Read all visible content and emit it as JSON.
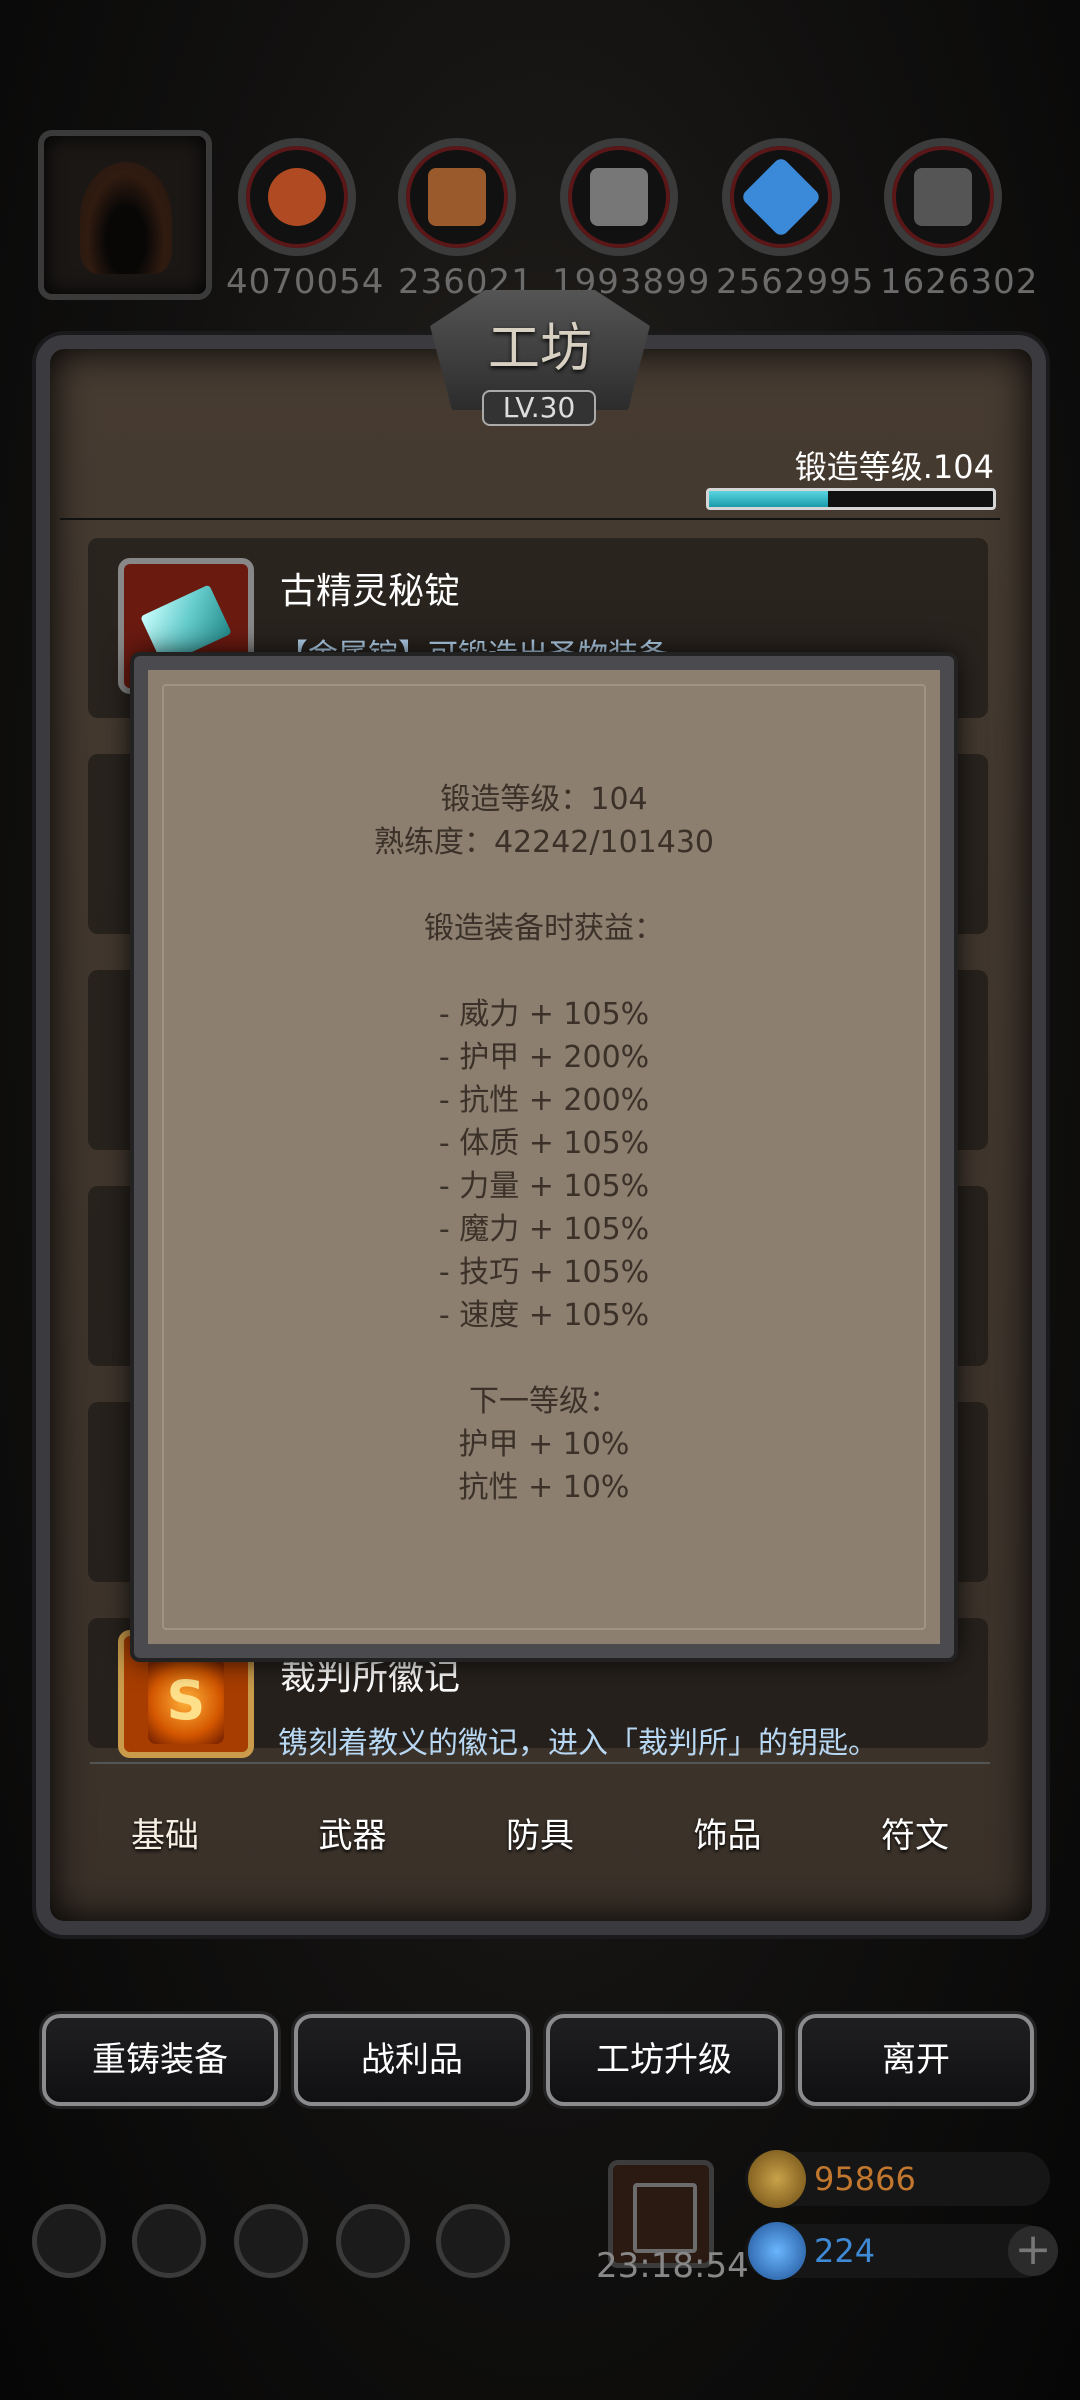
{
  "workshop": {
    "title": "工坊",
    "level": "LV.30"
  },
  "resources": [
    {
      "value": "4070054",
      "icon": "leather-icon",
      "color": "#b04a22"
    },
    {
      "value": "236021",
      "icon": "wood-plank-icon",
      "color": "#9a5a2c"
    },
    {
      "value": "1993899",
      "icon": "iron-ingot-icon",
      "color": "#777777"
    },
    {
      "value": "2562995",
      "icon": "crystal-icon",
      "color": "#3b8ad9"
    },
    {
      "value": "1626302",
      "icon": "steel-ingot-icon",
      "color": "#555555"
    }
  ],
  "forge": {
    "label": "锻造等级.104",
    "progress": 0.42
  },
  "items": [
    {
      "name": "古精灵秘锭",
      "desc": "【金属锭】可锻造出圣物装备。"
    },
    {
      "name": "裁判所徽记",
      "desc": "镌刻着教义的徽记，进入「裁判所」的钥匙。"
    }
  ],
  "tabs": [
    "基础",
    "武器",
    "防具",
    "饰品",
    "符文"
  ],
  "buttons": [
    "重铸装备",
    "战利品",
    "工坊升级",
    "离开"
  ],
  "bottom": {
    "time": "23:18:54",
    "gold": "95866",
    "gems": "224"
  },
  "popup": {
    "lines": [
      "锻造等级：104",
      "熟练度：42242/101430",
      "",
      "锻造装备时获益：",
      "",
      "- 威力 + 105%",
      "- 护甲 + 200%",
      "- 抗性 + 200%",
      "- 体质 + 105%",
      "- 力量 + 105%",
      "- 魔力 + 105%",
      "- 技巧 + 105%",
      "- 速度 + 105%",
      "",
      "下一等级：",
      "护甲 + 10%",
      "抗性 + 10%"
    ]
  },
  "colors": {
    "accent": "#5ad6e0",
    "popup_bg": "#8c7f70",
    "desc": "#b7d7f2"
  }
}
